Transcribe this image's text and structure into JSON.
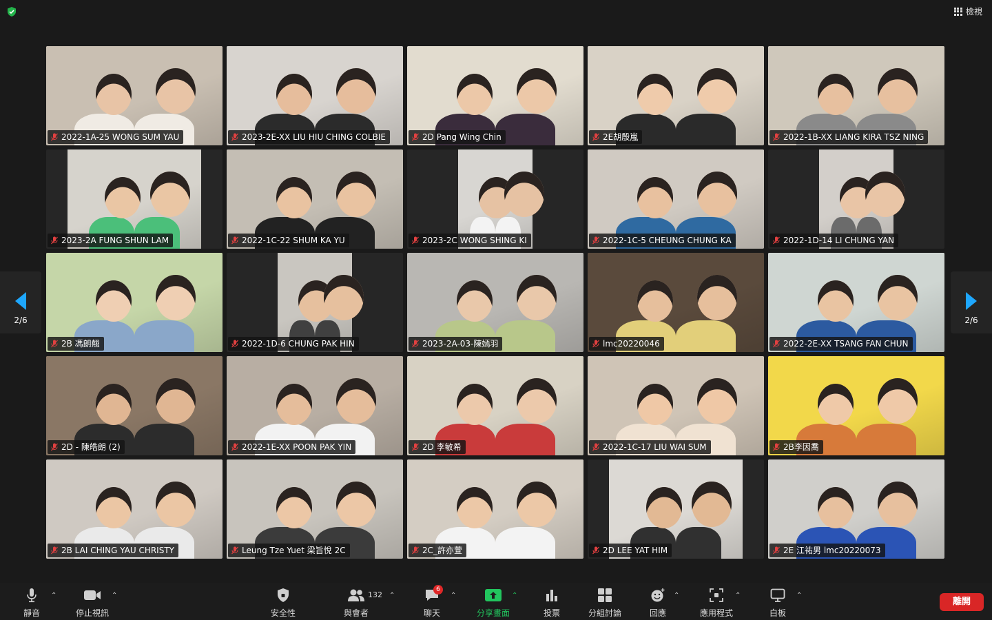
{
  "topbar": {
    "view_label": "檢視"
  },
  "pagination": {
    "left": "2/6",
    "right": "2/6"
  },
  "participants": [
    {
      "name": "2022-1A-25 WONG SUM YAU",
      "bg": "#c9bfb2",
      "skin": "#e8c4a6",
      "shirt": "#f0ebe4",
      "layout": "full"
    },
    {
      "name": "2023-2E-XX LIU HIU CHING COLBIE",
      "bg": "#d8d4cf",
      "skin": "#e6bd9c",
      "shirt": "#2b2b2b",
      "layout": "full"
    },
    {
      "name": "2D Pang Wing Chin",
      "bg": "#e2dccf",
      "skin": "#ecc8a8",
      "shirt": "#3a2c3c",
      "layout": "full"
    },
    {
      "name": "2E胡殷嵐",
      "bg": "#d9d2c6",
      "skin": "#efcbab",
      "shirt": "#2a2a2a",
      "layout": "full"
    },
    {
      "name": "2022-1B-XX LIANG KIRA TSZ NING",
      "bg": "#cfc8bb",
      "skin": "#e7c09f",
      "shirt": "#8a8a8a",
      "layout": "full"
    },
    {
      "name": "2023-2A FUNG SHUN LAM",
      "bg": "#d6d3cc",
      "skin": "#eac6a4",
      "shirt": "#4bbf7a",
      "layout": "narrow"
    },
    {
      "name": "2022-1C-22 SHUM KA YU",
      "bg": "#c4beb4",
      "skin": "#e9c3a1",
      "shirt": "#222",
      "layout": "full"
    },
    {
      "name": "2023-2C WONG SHING KI",
      "bg": "#d8d6d2",
      "skin": "#e6c2a3",
      "shirt": "#f3f3f3",
      "layout": "narrow2"
    },
    {
      "name": "2022-1C-5 CHEUNG CHUNG KA",
      "bg": "#d0cac2",
      "skin": "#e8c19f",
      "shirt": "#2f6aa1",
      "layout": "full"
    },
    {
      "name": "2022-1D-14 LI CHUNG YAN",
      "bg": "#d3cfca",
      "skin": "#e9c5a6",
      "shirt": "#6b6b6b",
      "layout": "narrow2"
    },
    {
      "name": "2B 馮朗翹",
      "bg": "#c5d6a8",
      "skin": "#efcfb3",
      "shirt": "#8aa7c9",
      "layout": "full"
    },
    {
      "name": "2022-1D-6 CHUNG PAK HIN",
      "bg": "#c9c6c0",
      "skin": "#e6c09e",
      "shirt": "#404040",
      "layout": "narrow2"
    },
    {
      "name": "2023-2A-03-陳嫣羽",
      "bg": "#b9b7b3",
      "skin": "#e9c8aa",
      "shirt": "#b8c78a",
      "layout": "full"
    },
    {
      "name": "lmc20220046",
      "bg": "#5a4a3c",
      "skin": "#e6bf9c",
      "shirt": "#e2cf7a",
      "layout": "full"
    },
    {
      "name": "2022-2E-XX TSANG FAN CHUN",
      "bg": "#cfd6d2",
      "skin": "#e9c4a2",
      "shirt": "#2c5aa0",
      "layout": "full"
    },
    {
      "name": "2D - 陳皓朗 (2)",
      "bg": "#8a7765",
      "skin": "#e0b693",
      "shirt": "#2c2c2c",
      "layout": "full"
    },
    {
      "name": "2022-1E-XX POON PAK YIN",
      "bg": "#b8aea3",
      "skin": "#e5bd9b",
      "shirt": "#f2f2f2",
      "layout": "full"
    },
    {
      "name": "2D 李敏希",
      "bg": "#d8d2c4",
      "skin": "#ecc9ab",
      "shirt": "#c93b3b",
      "layout": "full"
    },
    {
      "name": "2022-1C-17 LIU WAI SUM",
      "bg": "#cfc4b6",
      "skin": "#efc8a6",
      "shirt": "#f0e2d2",
      "layout": "full"
    },
    {
      "name": "2B李因喬",
      "bg": "#f2d84a",
      "skin": "#efc9a8",
      "shirt": "#d77a3a",
      "layout": "full"
    },
    {
      "name": "2B LAI CHING YAU CHRISTY",
      "bg": "#cfc9c2",
      "skin": "#ebc6a4",
      "shirt": "#eaeaea",
      "layout": "full"
    },
    {
      "name": "Leung Tze Yuet 梁旨悅 2C",
      "bg": "#c8c4bd",
      "skin": "#ecc7a6",
      "shirt": "#3b3b3b",
      "layout": "full"
    },
    {
      "name": "2C_許亦萱",
      "bg": "#d4cdc3",
      "skin": "#ecc8a7",
      "shirt": "#f3f3f3",
      "layout": "full"
    },
    {
      "name": "2D LEE YAT HIM",
      "bg": "#dcd9d4",
      "skin": "#e2b994",
      "shirt": "#303030",
      "layout": "mid"
    },
    {
      "name": "2E 江祐男 lmc20220073",
      "bg": "#d0cfcb",
      "skin": "#e7c09e",
      "shirt": "#2b54b5",
      "layout": "full"
    }
  ],
  "toolbar": {
    "mute": "靜音",
    "stop_video": "停止視訊",
    "security": "安全性",
    "participants": "與會者",
    "participant_count": "132",
    "chat": "聊天",
    "chat_badge": "6",
    "share_screen": "分享畫面",
    "polls": "投票",
    "breakout": "分組討論",
    "reactions": "回應",
    "apps": "應用程式",
    "whiteboard": "白板",
    "leave": "離開"
  },
  "colors": {
    "accent_green": "#22c55e",
    "leave_red": "#d92626",
    "arrow_blue": "#1ea7fd"
  }
}
